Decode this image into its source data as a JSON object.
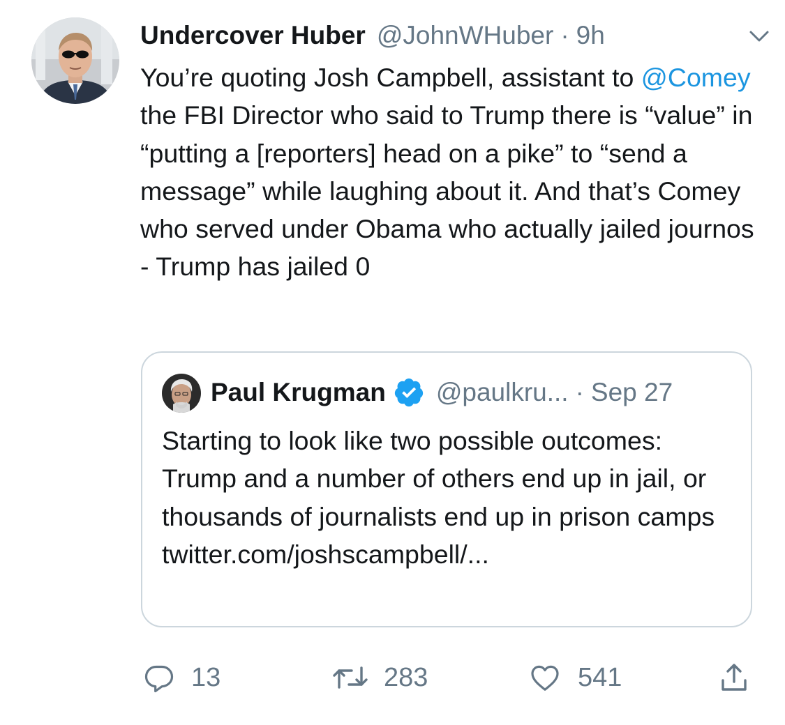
{
  "tweet": {
    "display_name": "Undercover Huber",
    "handle": "@JohnWHuber",
    "separator": "·",
    "time": "9h",
    "text_before_mention": "You’re quoting Josh Campbell, assistant to",
    "mention": "@Comey",
    "text_after_mention": "the FBI Director who said to Trump there is “value” in “putting a [reporters] head on a pike” to “send a message” while laughing about it. And that’s Comey who served under Obama who actually jailed journos - Trump has jailed 0",
    "icons": {
      "caret": "chevron-down-icon",
      "avatar": "avatar"
    }
  },
  "quoted_tweet": {
    "display_name": "Paul Krugman",
    "handle": "@paulkru...",
    "separator": "·",
    "time": "Sep 27",
    "text": "Starting to look like two possible outcomes: Trump and a number of others end up in jail, or thousands of journalists end up in prison camps twitter.com/joshscampbell/...",
    "verified": true
  },
  "actions": {
    "reply_count": "13",
    "retweet_count": "283",
    "like_count": "541"
  },
  "colors": {
    "text_primary": "#14171a",
    "text_secondary": "#657786",
    "link": "#1b95e0",
    "verified": "#1da1f2",
    "border": "#ccd6dd"
  }
}
